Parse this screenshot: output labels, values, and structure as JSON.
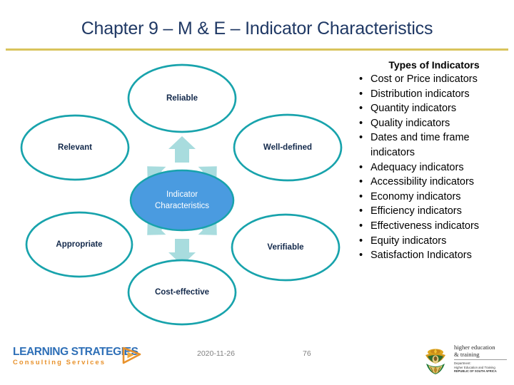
{
  "slide": {
    "title": "Chapter 9 – M & E – Indicator Characteristics",
    "accent_rule_color": "#D9C45C",
    "title_color": "#1F3864"
  },
  "diagram": {
    "type": "radial-cycle",
    "center": {
      "line1": "Indicator",
      "line2": "Characteristics",
      "fill_color": "#4A9BE0",
      "stroke_color": "#18A3AC",
      "text_color": "#FFFFFF"
    },
    "ellipse_stroke_color": "#18A3AC",
    "ellipse_fill_color": "#FFFFFF",
    "ellipse_label_color": "#13294B",
    "arrow_color": "#A8DCDE",
    "nodes": [
      {
        "label": "Reliable",
        "position": "top"
      },
      {
        "label": "Well-defined",
        "position": "right-top"
      },
      {
        "label": "Verifiable",
        "position": "right-bottom"
      },
      {
        "label": "Cost-effective",
        "position": "bottom"
      },
      {
        "label": "Appropriate",
        "position": "left-bottom"
      },
      {
        "label": "Relevant",
        "position": "left-top"
      }
    ]
  },
  "right_panel": {
    "heading": "Types of Indicators",
    "bullets": [
      "Cost or Price indicators",
      "Distribution indicators",
      "Quantity indicators",
      "Quality indicators",
      "Dates and time frame indicators",
      "Adequacy indicators",
      "Accessibility indicators",
      "Economy indicators",
      "Efficiency indicators",
      "Effectiveness indicators",
      "Equity indicators",
      "Satisfaction Indicators"
    ]
  },
  "footer": {
    "logo_line1": "LEARNING STRATEGIES",
    "logo_line2": "Consulting Services",
    "logo_blue": "#2E6FB7",
    "logo_orange": "#E8922C",
    "date": "2020-11-26",
    "page_number": "76",
    "dhet": {
      "line1": "higher education",
      "line2": "& training",
      "dept": "Department:",
      "dept2": "Higher Education and Training",
      "country": "REPUBLIC OF SOUTH AFRICA"
    }
  }
}
